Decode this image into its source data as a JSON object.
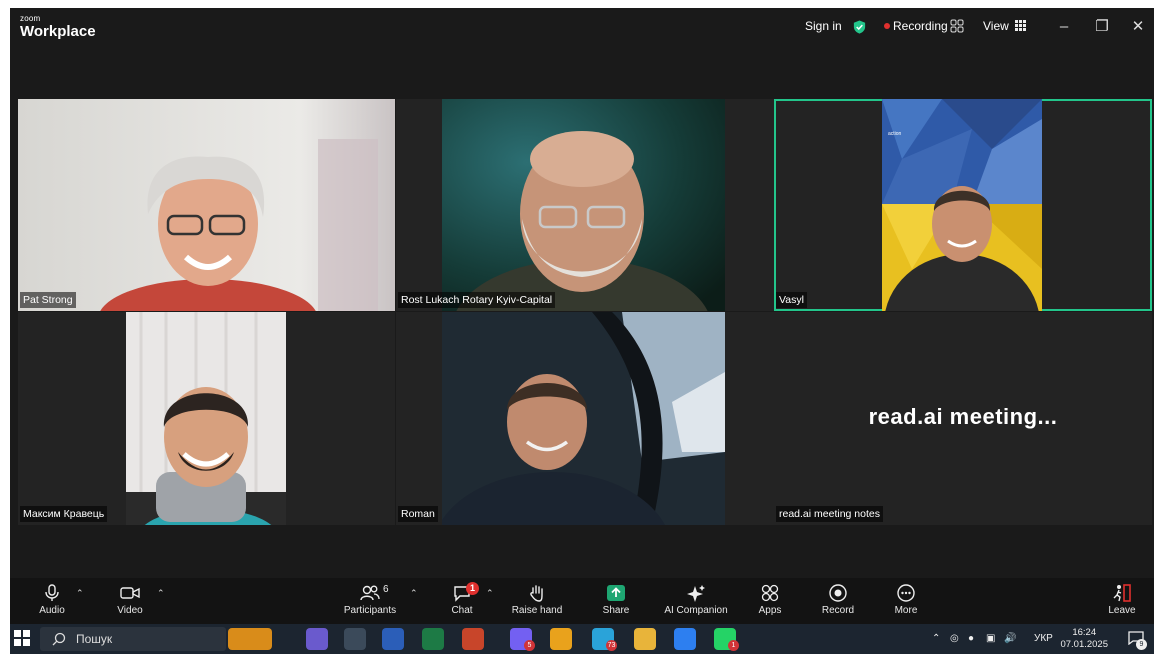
{
  "titlebar": {
    "logo_top": "zoom",
    "logo_main": "Workplace",
    "sign_in": "Sign in",
    "recording": "Recording",
    "view": "View",
    "security_color": "#23c58b",
    "recording_color": "#e0302e"
  },
  "tiles": [
    {
      "name": "Pat Strong",
      "active": false
    },
    {
      "name": "Rost Lukach Rotary Kyiv-Capital",
      "active": false
    },
    {
      "name": "Vasyl",
      "active": true
    },
    {
      "name": "Максим Кравець",
      "active": false
    },
    {
      "name": "Roman",
      "active": false
    },
    {
      "name": "read.ai meeting notes",
      "active": false,
      "center_text": "read.ai  meeting..."
    }
  ],
  "toolbar": {
    "audio": "Audio",
    "video": "Video",
    "participants": "Participants",
    "participants_count": "6",
    "chat": "Chat",
    "chat_badge": "1",
    "raise_hand": "Raise hand",
    "share": "Share",
    "ai_companion": "AI Companion",
    "apps": "Apps",
    "record": "Record",
    "more": "More",
    "leave": "Leave",
    "share_color": "#1ea672",
    "leave_color": "#e0302e"
  },
  "taskbar": {
    "search_placeholder": "Пошук",
    "apps": [
      {
        "icon": "briefcase-icon",
        "color": "#d98c1a",
        "badge": ""
      },
      {
        "icon": "copilot-icon",
        "color": "#6a5acd",
        "badge": ""
      },
      {
        "icon": "calculator-icon",
        "color": "#3b4a5a",
        "badge": ""
      },
      {
        "icon": "word-icon",
        "color": "#2b5eb8",
        "badge": ""
      },
      {
        "icon": "excel-icon",
        "color": "#1d7a45",
        "badge": ""
      },
      {
        "icon": "powerpoint-icon",
        "color": "#c8452a",
        "badge": ""
      },
      {
        "icon": "viber-icon",
        "color": "#7360f2",
        "badge": "5"
      },
      {
        "icon": "chrome-icon",
        "color": "#e9a21c",
        "badge": ""
      },
      {
        "icon": "telegram-icon",
        "color": "#2aa3d9",
        "badge": "73"
      },
      {
        "icon": "file-explorer-icon",
        "color": "#e8b43a",
        "badge": ""
      },
      {
        "icon": "zoom-icon",
        "color": "#2d7ff0",
        "badge": ""
      },
      {
        "icon": "whatsapp-icon",
        "color": "#25d366",
        "badge": "1"
      }
    ],
    "language": "УКР",
    "time": "16:24",
    "date": "07.01.2025",
    "notifications": "9"
  }
}
